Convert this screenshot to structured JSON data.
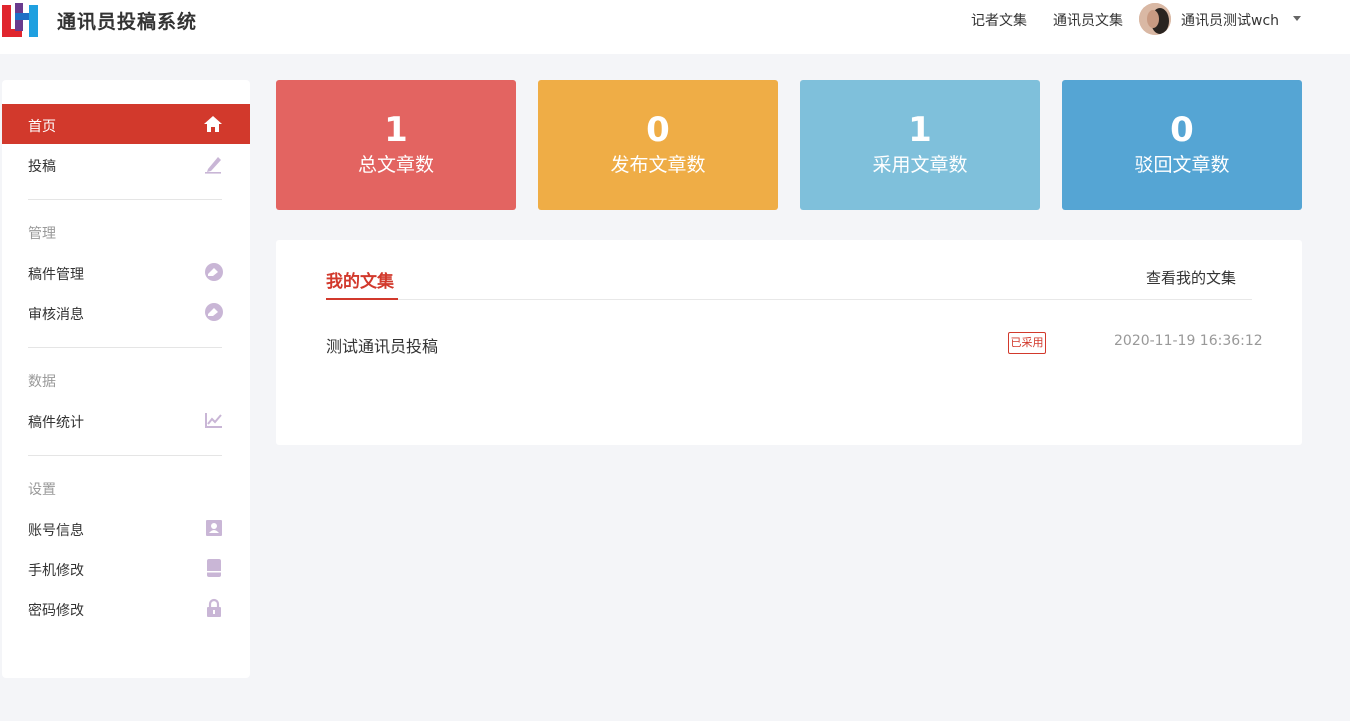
{
  "header": {
    "app_title": "通讯员投稿系统",
    "links": [
      "记者文集",
      "通讯员文集"
    ],
    "user": "通讯员测试wch"
  },
  "sidebar": {
    "items": [
      {
        "label": "首页",
        "icon": "home-icon",
        "active": true
      },
      {
        "label": "投稿",
        "icon": "pen-icon"
      }
    ],
    "groups": [
      {
        "title": "管理",
        "items": [
          {
            "label": "稿件管理",
            "icon": "eraser-icon"
          },
          {
            "label": "审核消息",
            "icon": "eraser-icon"
          }
        ]
      },
      {
        "title": "数据",
        "items": [
          {
            "label": "稿件统计",
            "icon": "line-chart-icon"
          }
        ]
      },
      {
        "title": "设置",
        "items": [
          {
            "label": "账号信息",
            "icon": "user-card-icon"
          },
          {
            "label": "手机修改",
            "icon": "phone-icon"
          },
          {
            "label": "密码修改",
            "icon": "lock-icon"
          }
        ]
      }
    ]
  },
  "stats": [
    {
      "value": "1",
      "label": "总文章数",
      "color": "#e36461"
    },
    {
      "value": "0",
      "label": "发布文章数",
      "color": "#efad46"
    },
    {
      "value": "1",
      "label": "采用文章数",
      "color": "#7fc0db"
    },
    {
      "value": "0",
      "label": "驳回文章数",
      "color": "#55a5d4"
    }
  ],
  "panel": {
    "title": "我的文集",
    "link": "查看我的文集",
    "rows": [
      {
        "title": "测试通讯员投稿",
        "status": "已采用",
        "time": "2020-11-19 16:36:12"
      }
    ]
  },
  "colors": {
    "accent": "#d2392c",
    "sidebar_icon": "#c9b6d6"
  }
}
